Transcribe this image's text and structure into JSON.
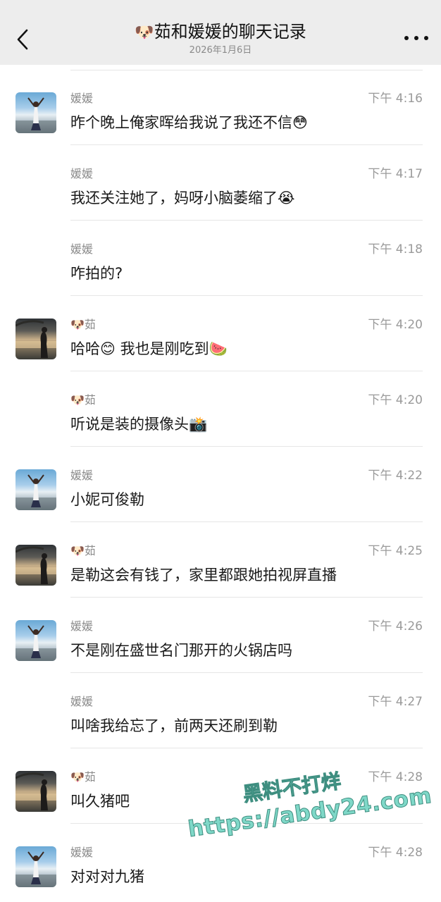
{
  "header": {
    "title_emoji": "🐶",
    "title": "茹和媛媛的聊天记录",
    "subtitle": "2026年1月6日",
    "back_icon": "chevron-left-icon",
    "more_icon": "more-dots-icon"
  },
  "messages": [
    {
      "avatar": "yuan",
      "name": "媛媛",
      "time": "下午 4:16",
      "text": "昨个晚上俺家晖给我说了我还不信😳"
    },
    {
      "avatar": "",
      "name": "媛媛",
      "time": "下午 4:17",
      "text": "我还关注她了，妈呀小脑萎缩了😭"
    },
    {
      "avatar": "",
      "name": "媛媛",
      "time": "下午 4:18",
      "text": "咋拍的?"
    },
    {
      "avatar": "ru",
      "name": "🐶茹",
      "time": "下午 4:20",
      "text": "哈哈😊 我也是刚吃到🍉"
    },
    {
      "avatar": "",
      "name": "🐶茹",
      "time": "下午 4:20",
      "text": "听说是装的摄像头📸"
    },
    {
      "avatar": "yuan",
      "name": "媛媛",
      "time": "下午 4:22",
      "text": "小妮可俊勒"
    },
    {
      "avatar": "ru",
      "name": "🐶茹",
      "time": "下午 4:25",
      "text": "是勒这会有钱了，家里都跟她拍视屏直播"
    },
    {
      "avatar": "yuan",
      "name": "媛媛",
      "time": "下午 4:26",
      "text": "不是刚在盛世名门那开的火锅店吗"
    },
    {
      "avatar": "",
      "name": "媛媛",
      "time": "下午 4:27",
      "text": "叫啥我给忘了，前两天还刷到勒"
    },
    {
      "avatar": "ru",
      "name": "🐶茹",
      "time": "下午 4:28",
      "text": "叫久猪吧"
    },
    {
      "avatar": "yuan",
      "name": "媛媛",
      "time": "下午 4:28",
      "text": "对对对九猪"
    }
  ],
  "watermark": {
    "line1": "黑料不打烊",
    "line2": "https://abdy24.com"
  }
}
